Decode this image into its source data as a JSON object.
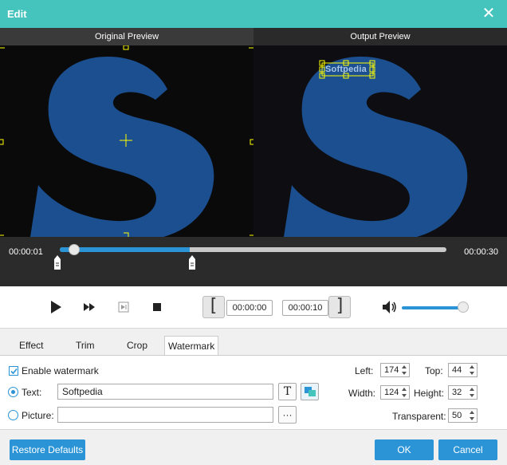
{
  "window": {
    "title": "Edit"
  },
  "preview": {
    "original_label": "Original Preview",
    "output_label": "Output Preview",
    "watermark_text": "Softpedia"
  },
  "timeline": {
    "current_time": "00:00:01",
    "total_time": "00:00:30",
    "progress": 0.336
  },
  "playback": {
    "clip_start": "00:00:00",
    "clip_end": "00:00:10",
    "volume": 0.93
  },
  "tabs": [
    {
      "label": "Effect",
      "active": false
    },
    {
      "label": "Trim",
      "active": false
    },
    {
      "label": "Crop",
      "active": false
    },
    {
      "label": "Watermark",
      "active": true
    }
  ],
  "watermark": {
    "enable_label": "Enable watermark",
    "enabled": true,
    "text_label": "Text:",
    "text_value": "Softpedia",
    "picture_label": "Picture:",
    "picture_value": "",
    "browse_label": "···",
    "left_label": "Left:",
    "left_value": "174",
    "top_label": "Top:",
    "top_value": "44",
    "width_label": "Width:",
    "width_value": "124",
    "height_label": "Height:",
    "height_value": "32",
    "transparent_label": "Transparent:",
    "transparent_value": "50"
  },
  "footer": {
    "restore_label": "Restore Defaults",
    "ok_label": "OK",
    "cancel_label": "Cancel"
  },
  "colors": {
    "titlebar": "#45c3bd",
    "accent": "#2b94d6",
    "logo_blue": "#1b4f8f"
  }
}
